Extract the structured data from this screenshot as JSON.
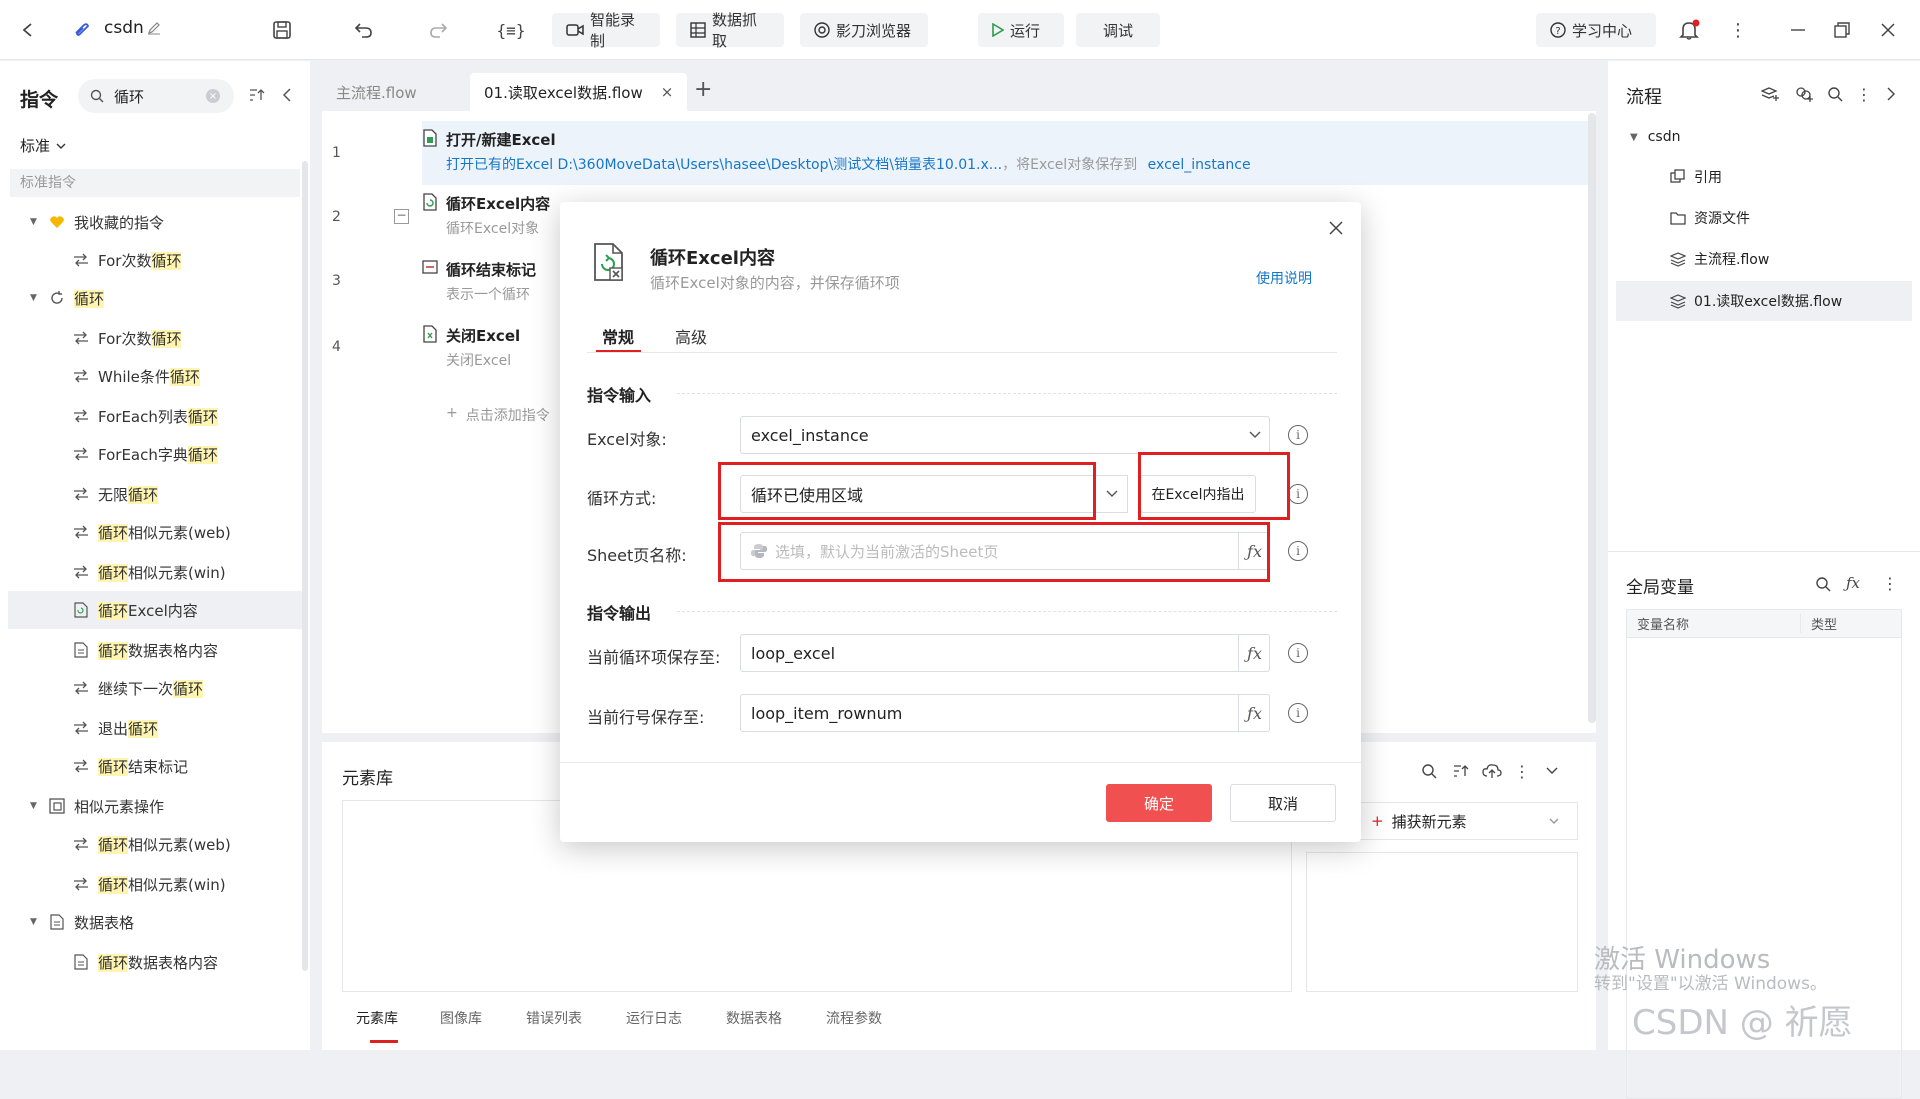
{
  "topbar": {
    "project_name": "csdn",
    "buttons": {
      "smart_record": "智能录制",
      "data_grab": "数据抓取",
      "browser": "影刀浏览器",
      "run": "运行",
      "debug": "调试",
      "learn": "学习中心"
    }
  },
  "left": {
    "title": "指令",
    "search_value": "循环",
    "dropdown": "标准",
    "section": "标准指令",
    "items": [
      {
        "label_pre": "",
        "label_hl": "",
        "label_post": "我收藏的指令",
        "icon": "heart-icon"
      },
      {
        "label_pre": "For次数",
        "label_hl": "循环",
        "label_post": "",
        "icon": "loop-icon"
      },
      {
        "label_pre": "",
        "label_hl": "循环",
        "label_post": "",
        "icon": "refresh-icon"
      },
      {
        "label_pre": "For次数",
        "label_hl": "循环",
        "label_post": "",
        "icon": "loop-icon"
      },
      {
        "label_pre": "While条件",
        "label_hl": "循环",
        "label_post": "",
        "icon": "loop-icon"
      },
      {
        "label_pre": "ForEach列表",
        "label_hl": "循环",
        "label_post": "",
        "icon": "loop-icon"
      },
      {
        "label_pre": "ForEach字典",
        "label_hl": "循环",
        "label_post": "",
        "icon": "loop-icon"
      },
      {
        "label_pre": "无限",
        "label_hl": "循环",
        "label_post": "",
        "icon": "loop-icon"
      },
      {
        "label_pre": "",
        "label_hl": "循环",
        "label_post": "相似元素(web)",
        "icon": "loop-icon"
      },
      {
        "label_pre": "",
        "label_hl": "循环",
        "label_post": "相似元素(win)",
        "icon": "loop-icon"
      },
      {
        "label_pre": "",
        "label_hl": "循环",
        "label_post": "Excel内容",
        "icon": "excel-icon"
      },
      {
        "label_pre": "",
        "label_hl": "循环",
        "label_post": "数据表格内容",
        "icon": "table-icon"
      },
      {
        "label_pre": "继续下一次",
        "label_hl": "循环",
        "label_post": "",
        "icon": "loop-icon"
      },
      {
        "label_pre": "退出",
        "label_hl": "循环",
        "label_post": "",
        "icon": "loop-icon"
      },
      {
        "label_pre": "",
        "label_hl": "循环",
        "label_post": "结束标记",
        "icon": "loop-icon"
      },
      {
        "label_pre": "",
        "label_hl": "",
        "label_post": "相似元素操作",
        "icon": "copy-icon"
      },
      {
        "label_pre": "",
        "label_hl": "循环",
        "label_post": "相似元素(web)",
        "icon": "loop-icon"
      },
      {
        "label_pre": "",
        "label_hl": "循环",
        "label_post": "相似元素(win)",
        "icon": "loop-icon"
      },
      {
        "label_pre": "",
        "label_hl": "",
        "label_post": "数据表格",
        "icon": "table-icon"
      },
      {
        "label_pre": "",
        "label_hl": "循环",
        "label_post": "数据表格内容",
        "icon": "table-icon"
      }
    ]
  },
  "tabs": [
    "主流程.flow",
    "01.读取excel数据.flow"
  ],
  "steps": [
    {
      "num": "1",
      "title": "打开/新建Excel",
      "desc": "打开已有的Excel D:\\360MoveData\\Users\\hasee\\Desktop\\测试文档\\销量表10.01.x...",
      "desc2": "，将Excel对象保存到",
      "var": "excel_instance"
    },
    {
      "num": "2",
      "title": "循环Excel内容",
      "desc": "循环Excel对象"
    },
    {
      "num": "3",
      "title": "循环结束标记",
      "desc": "表示一个循环"
    },
    {
      "num": "4",
      "title": "关闭Excel",
      "desc": "关闭Excel"
    }
  ],
  "add_step": "点击添加指令",
  "bottom": {
    "title": "元素库",
    "capture": "捕获新元素",
    "tabs": [
      "元素库",
      "图像库",
      "错误列表",
      "运行日志",
      "数据表格",
      "流程参数"
    ]
  },
  "right": {
    "title": "流程",
    "root": "csdn",
    "items": [
      "引用",
      "资源文件",
      "主流程.flow",
      "01.读取excel数据.flow"
    ],
    "vars_title": "全局变量",
    "col_name": "变量名称",
    "col_type": "类型",
    "watermark1": "激活 Windows",
    "watermark2": "转到\"设置\"以激活 Windows。",
    "csdn_mark": "CSDN @ 祈愿"
  },
  "modal": {
    "title": "循环Excel内容",
    "subtitle": "循环Excel对象的内容，并保存循环项",
    "help": "使用说明",
    "tab_general": "常规",
    "tab_advanced": "高级",
    "section_input": "指令输入",
    "section_output": "指令输出",
    "excel_label": "Excel对象:",
    "excel_value": "excel_instance",
    "loop_label": "循环方式:",
    "loop_value": "循环已使用区域",
    "point_btn": "在Excel内指出",
    "sheet_label": "Sheet页名称:",
    "sheet_placeholder": "选填，默认为当前激活的Sheet页",
    "cur_label": "当前循环项保存至:",
    "cur_value": "loop_excel",
    "row_label": "当前行号保存至:",
    "row_value": "loop_item_rownum",
    "ok": "确定",
    "cancel": "取消"
  },
  "colors": {
    "accent": "#1677c8",
    "danger": "#f0504f",
    "highlight": "#fff5b1",
    "red_box": "#e02020"
  }
}
